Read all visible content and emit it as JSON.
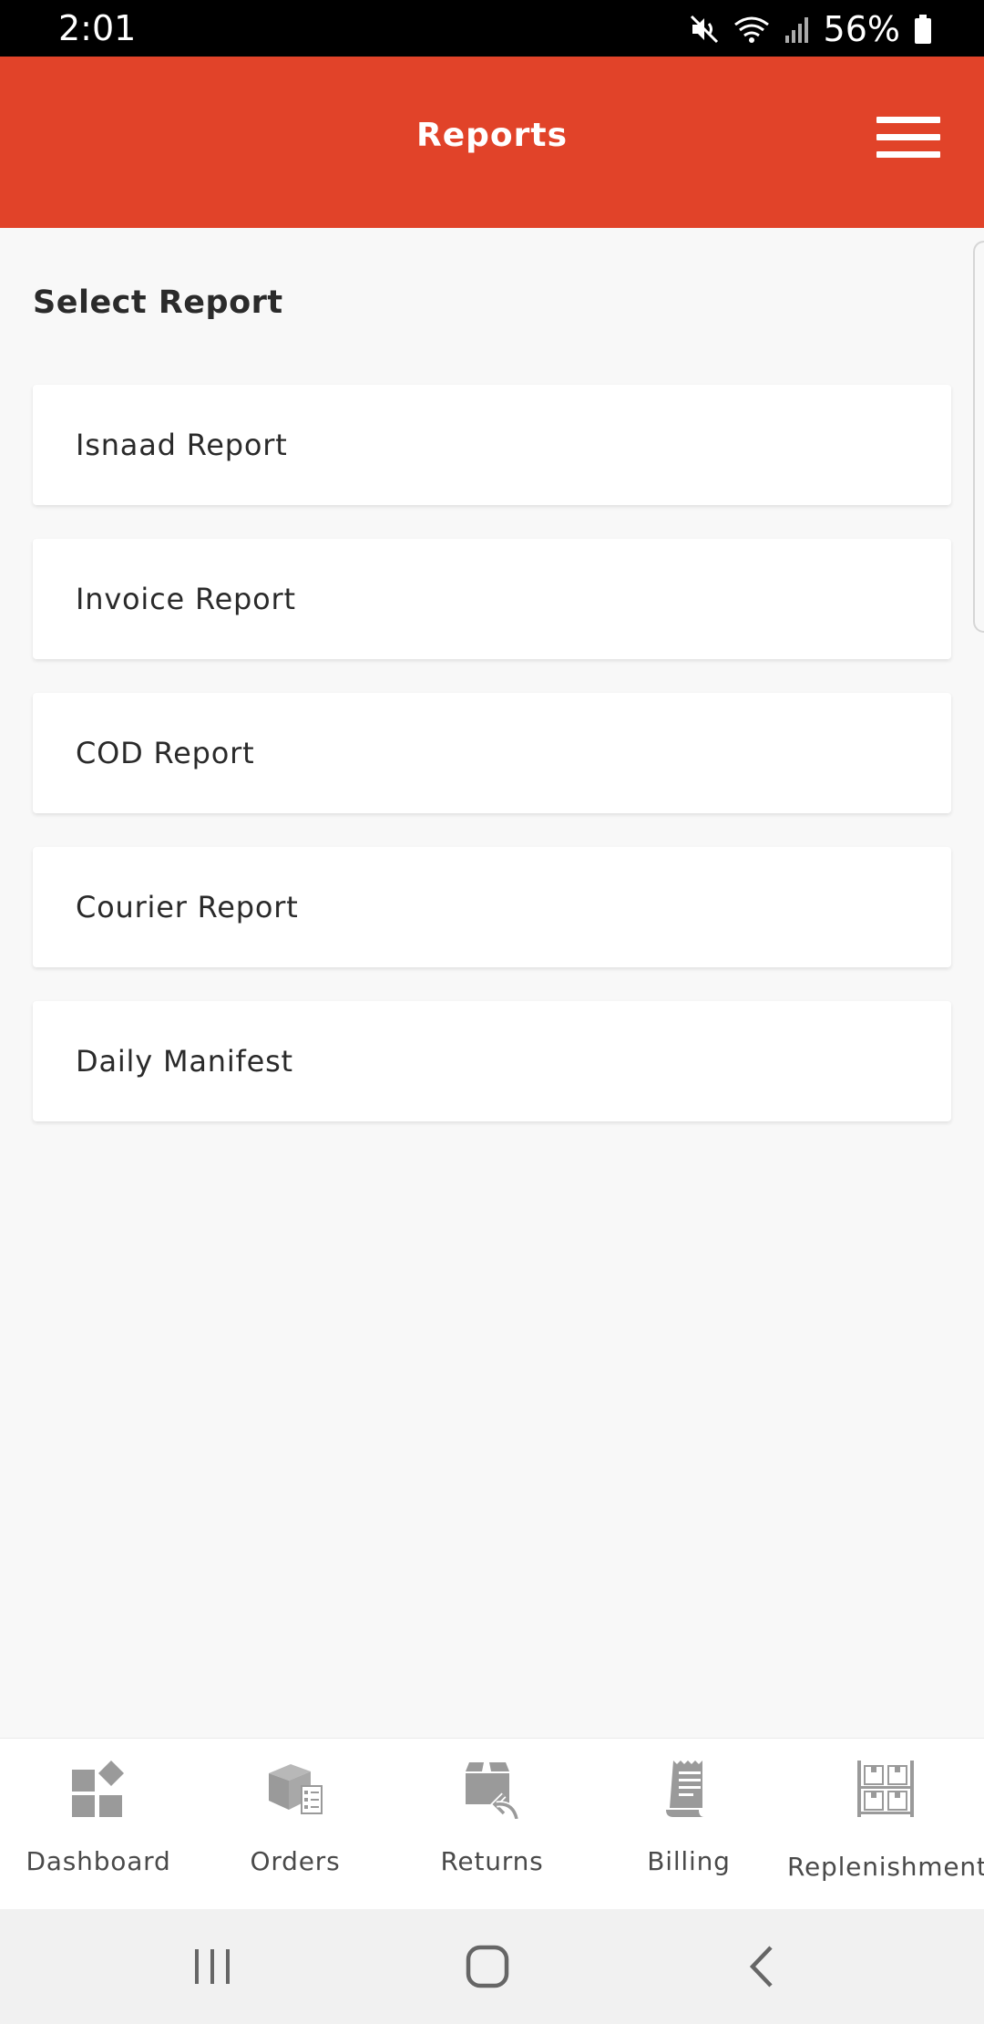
{
  "status_bar": {
    "time": "2:01",
    "battery": "56%"
  },
  "app_bar": {
    "title": "Reports"
  },
  "main": {
    "section_title": "Select Report",
    "reports": [
      {
        "label": "Isnaad Report"
      },
      {
        "label": "Invoice Report"
      },
      {
        "label": "COD Report"
      },
      {
        "label": "Courier Report"
      },
      {
        "label": "Daily Manifest"
      }
    ]
  },
  "bottom_nav": {
    "items": [
      {
        "label": "Dashboard",
        "icon": "dashboard-icon"
      },
      {
        "label": "Orders",
        "icon": "orders-icon"
      },
      {
        "label": "Returns",
        "icon": "returns-icon"
      },
      {
        "label": "Billing",
        "icon": "billing-icon"
      },
      {
        "label": "Replenishment",
        "icon": "replenishment-icon"
      }
    ]
  },
  "colors": {
    "accent": "#e14329",
    "background": "#f8f8f8",
    "nav_icon": "#9a9a9a"
  }
}
